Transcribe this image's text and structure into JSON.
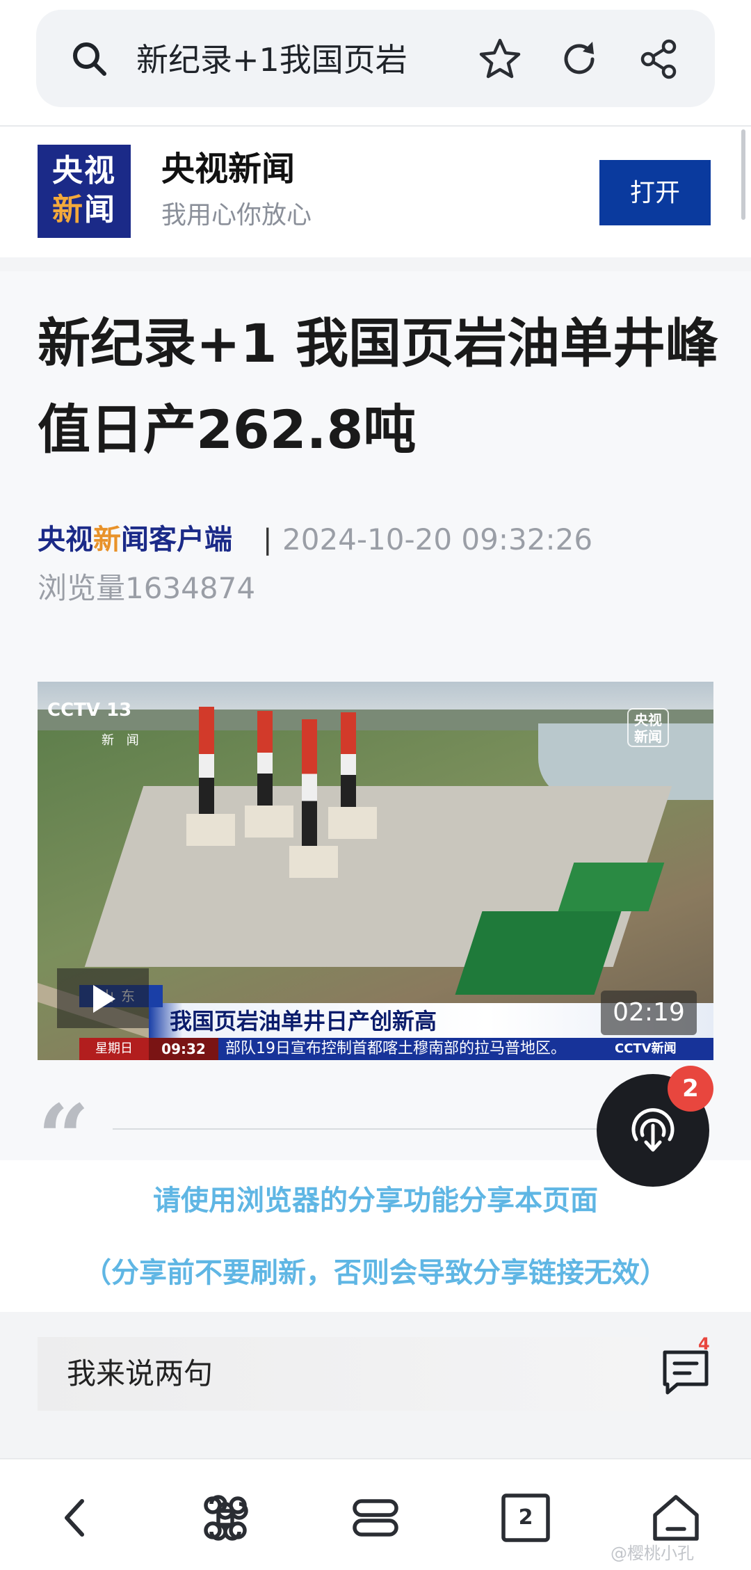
{
  "browser": {
    "search_text": "新纪录+1我国页岩",
    "icons": [
      "search-icon",
      "star-icon",
      "refresh-icon",
      "share-icon"
    ]
  },
  "banner": {
    "logo_line1": "央视",
    "logo_line2_a": "新",
    "logo_line2_b": "闻",
    "app_name": "央视新闻",
    "slogan": "我用心你放心",
    "open_label": "打开",
    "brand_color": "#0a3a9e"
  },
  "article": {
    "title": "新纪录+1 我国页岩油单井峰值日产262.8吨",
    "source_a": "央视",
    "source_hl": "新",
    "source_b": "闻客户端",
    "separator": "|",
    "time": "2024-10-20 09:32:26",
    "views_label": "浏览量",
    "views": "1634874"
  },
  "video": {
    "channel": "CCTV 13",
    "channel_sub": "新 闻",
    "corner_logo": "央视\n新闻",
    "location": "山东",
    "headline": "我国页岩油单井日产创新高",
    "ticker_day": "星期日",
    "ticker_clock": "09:32",
    "ticker_text": "部队19日宣布控制首都喀土穆南部的拉马普地区。",
    "ticker_logo": "CCTV新闻",
    "duration": "02:19"
  },
  "share_notice": {
    "line1": "请使用浏览器的分享功能分享本页面",
    "line2": "（分享前不要刷新，否则会导致分享链接无效）",
    "color": "#5fb6e4"
  },
  "fab": {
    "badge": "2",
    "icon": "download-icon"
  },
  "comment": {
    "placeholder": "我来说两句",
    "count": "4"
  },
  "nav": {
    "icons": [
      "back-icon",
      "command-icon",
      "menu-icon",
      "tabs-icon",
      "home-icon"
    ],
    "tab_count": "2"
  },
  "watermark": "@樱桃小孔"
}
